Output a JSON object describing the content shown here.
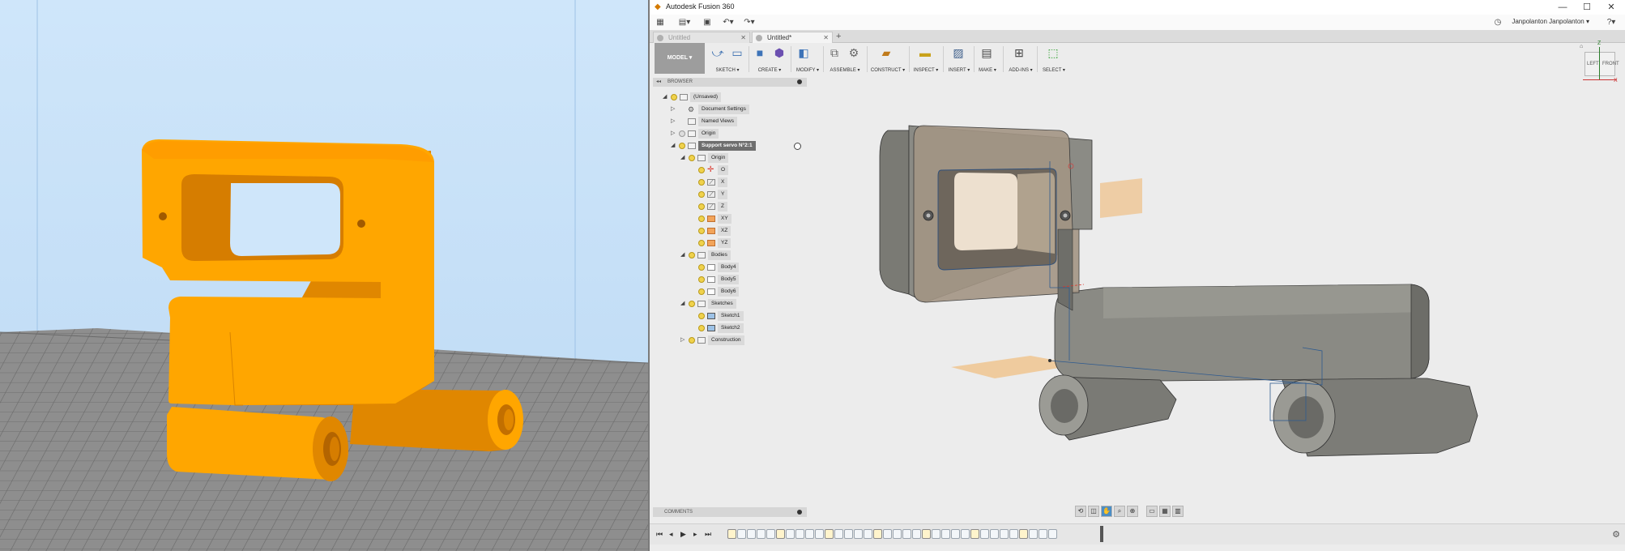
{
  "window": {
    "title": "Autodesk Fusion 360"
  },
  "window_controls": {
    "minimize": "—",
    "maximize": "☐",
    "close": "✕"
  },
  "quick_access": {
    "user": "Janpolanton Janpolanton ▾",
    "help": "?▾"
  },
  "tabs": [
    {
      "label": "Untitled",
      "active": false
    },
    {
      "label": "Untitled*",
      "active": true
    }
  ],
  "ribbon": {
    "workspace": "MODEL ▾",
    "groups": [
      "SKETCH ▾",
      "CREATE ▾",
      "MODIFY ▾",
      "ASSEMBLE ▾",
      "CONSTRUCT ▾",
      "INSPECT ▾",
      "INSERT ▾",
      "MAKE ▾",
      "ADD-INS ▾",
      "SELECT ▾"
    ]
  },
  "browser": {
    "header": "BROWSER",
    "tree": [
      {
        "label": "(Unsaved)",
        "icon": "document-icon",
        "level": 0,
        "expanded": true
      },
      {
        "label": "Document Settings",
        "icon": "gear-icon",
        "level": 1,
        "expanded": false
      },
      {
        "label": "Named Views",
        "icon": "folder-icon",
        "level": 1,
        "expanded": false
      },
      {
        "label": "Origin",
        "icon": "folder-icon",
        "level": 1,
        "expanded": false
      },
      {
        "label": "Support servo N°2:1",
        "icon": "component-icon",
        "level": 1,
        "expanded": true,
        "selected": true
      },
      {
        "label": "Origin",
        "icon": "folder-icon",
        "level": 2,
        "expanded": true
      },
      {
        "label": "O",
        "icon": "point-icon",
        "level": 3
      },
      {
        "label": "X",
        "icon": "axis-icon",
        "level": 3
      },
      {
        "label": "Y",
        "icon": "axis-icon",
        "level": 3
      },
      {
        "label": "Z",
        "icon": "axis-icon",
        "level": 3
      },
      {
        "label": "XY",
        "icon": "plane-icon",
        "level": 3
      },
      {
        "label": "XZ",
        "icon": "plane-icon",
        "level": 3
      },
      {
        "label": "YZ",
        "icon": "plane-icon",
        "level": 3
      },
      {
        "label": "Bodies",
        "icon": "folder-icon",
        "level": 2,
        "expanded": true
      },
      {
        "label": "Body4",
        "icon": "body-icon",
        "level": 3
      },
      {
        "label": "Body5",
        "icon": "body-icon",
        "level": 3
      },
      {
        "label": "Body6",
        "icon": "body-icon",
        "level": 3
      },
      {
        "label": "Sketches",
        "icon": "folder-icon",
        "level": 2,
        "expanded": true
      },
      {
        "label": "Sketch1",
        "icon": "sketch-icon",
        "level": 3
      },
      {
        "label": "Sketch2",
        "icon": "sketch-icon",
        "level": 3
      },
      {
        "label": "Construction",
        "icon": "folder-icon",
        "level": 2,
        "expanded": false
      }
    ]
  },
  "viewcube": {
    "axis_z": "Z",
    "left": "LEFT",
    "front": "FRONT",
    "axis_x": "X"
  },
  "comments": {
    "header": "COMMENTS"
  },
  "timeline": {
    "item_count": 34
  },
  "colors": {
    "slicer_part": "#ffa500",
    "fusion_body": "#8c8c86",
    "selection": "#6e6e6e",
    "ribbon_bg": "#ececec"
  }
}
